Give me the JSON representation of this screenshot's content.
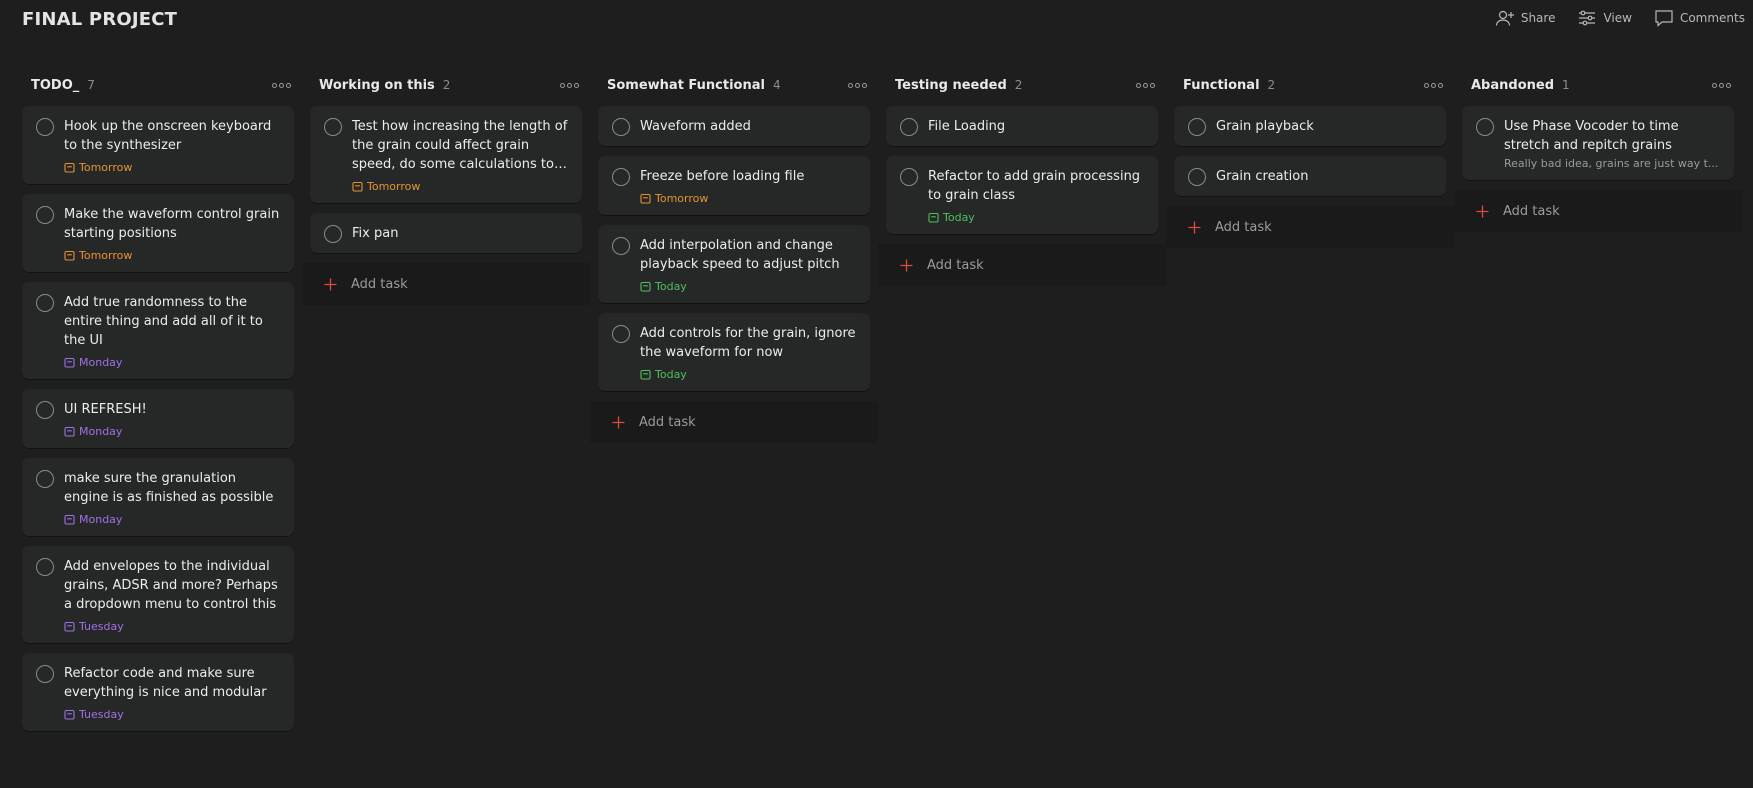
{
  "project": {
    "title": "FINAL PROJECT"
  },
  "header_actions": [
    {
      "label": "Share",
      "icon": "add-person-icon"
    },
    {
      "label": "View",
      "icon": "sliders-icon"
    },
    {
      "label": "Comments",
      "icon": "comment-icon"
    }
  ],
  "colors": {
    "tomorrow": "#e8922e",
    "today": "#4fbf5c",
    "weekday": "#a070e6",
    "add_plus": "#dd4b39"
  },
  "columns": [
    {
      "name": "TODO_",
      "count": "7",
      "tasks": [
        {
          "title": "Hook up the onscreen keyboard to the synthesizer",
          "due": "Tomorrow",
          "due_type": "tomorrow"
        },
        {
          "title": "Make the waveform control grain starting positions",
          "due": "Tomorrow",
          "due_type": "tomorrow"
        },
        {
          "title": "Add true randomness to the entire thing and add all of it to the UI",
          "due": "Monday",
          "due_type": "weekday"
        },
        {
          "title": "UI REFRESH!",
          "due": "Monday",
          "due_type": "weekday"
        },
        {
          "title": "make sure the granulation engine is as finished as possible",
          "due": "Monday",
          "due_type": "weekday"
        },
        {
          "title": "Add envelopes to the individual grains, ADSR and more? Perhaps a dropdown menu to control this",
          "due": "Tuesday",
          "due_type": "weekday"
        },
        {
          "title": "Refactor code and make sure everything is nice and modular",
          "due": "Tuesday",
          "due_type": "weekday"
        }
      ],
      "add_label": ""
    },
    {
      "name": "Working on this",
      "count": "2",
      "tasks": [
        {
          "title": "Test how increasing the length of the grain could affect grain speed, do some calculations to figure out the correct value",
          "due": "Tomorrow",
          "due_type": "tomorrow",
          "clamp": true
        },
        {
          "title": "Fix pan"
        }
      ],
      "add_label": "Add task"
    },
    {
      "name": "Somewhat Functional",
      "count": "4",
      "tasks": [
        {
          "title": "Waveform added"
        },
        {
          "title": "Freeze before loading file",
          "due": "Tomorrow",
          "due_type": "tomorrow"
        },
        {
          "title": "Add interpolation and change playback speed to adjust pitch",
          "due": "Today",
          "due_type": "today"
        },
        {
          "title": "Add controls for the grain, ignore the waveform for now",
          "due": "Today",
          "due_type": "today"
        }
      ],
      "add_label": "Add task"
    },
    {
      "name": "Testing needed",
      "count": "2",
      "tasks": [
        {
          "title": "File Loading"
        },
        {
          "title": "Refactor to add grain processing to grain class",
          "due": "Today",
          "due_type": "today"
        }
      ],
      "add_label": "Add task"
    },
    {
      "name": "Functional",
      "count": "2",
      "tasks": [
        {
          "title": "Grain playback"
        },
        {
          "title": "Grain creation"
        }
      ],
      "add_label": "Add task"
    },
    {
      "name": "Abandoned",
      "count": "1",
      "tasks": [
        {
          "title": "Use Phase Vocoder to time stretch and repitch grains",
          "description": "Really bad idea, grains are just way t..."
        }
      ],
      "add_label": "Add task"
    }
  ]
}
